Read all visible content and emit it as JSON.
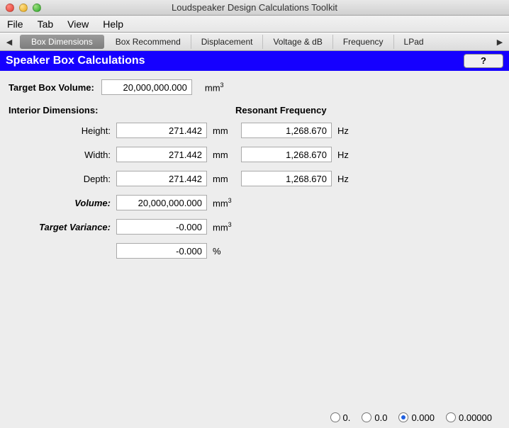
{
  "window": {
    "title": "Loudspeaker Design Calculations Toolkit"
  },
  "menubar": {
    "items": [
      "File",
      "Tab",
      "View",
      "Help"
    ]
  },
  "tabs": {
    "items": [
      "Box Dimensions",
      "Box Recommend",
      "Displacement",
      "Voltage & dB",
      "Frequency",
      "LPad"
    ],
    "active": "Box Dimensions",
    "scroll_left": "◀",
    "scroll_right": "▶"
  },
  "header": {
    "title": "Speaker Box Calculations",
    "help": "?"
  },
  "form": {
    "target_label": "Target Box Volume:",
    "target_value": "20,000,000.000",
    "target_unit": "mm",
    "interior_label": "Interior Dimensions:",
    "resonant_label": "Resonant Frequency",
    "rows": {
      "height": {
        "label": "Height:",
        "value": "271.442",
        "unit": "mm",
        "freq": "1,268.670",
        "freq_unit": "Hz"
      },
      "width": {
        "label": "Width:",
        "value": "271.442",
        "unit": "mm",
        "freq": "1,268.670",
        "freq_unit": "Hz"
      },
      "depth": {
        "label": "Depth:",
        "value": "271.442",
        "unit": "mm",
        "freq": "1,268.670",
        "freq_unit": "Hz"
      },
      "volume": {
        "label": "Volume:",
        "value": "20,000,000.000",
        "unit": "mm"
      },
      "variance": {
        "label": "Target Variance:",
        "value": "-0.000",
        "unit": "mm"
      },
      "variance_pct": {
        "value": "-0.000",
        "unit": "%"
      }
    }
  },
  "precision": {
    "options": [
      "0.",
      "0.0",
      "0.000",
      "0.00000"
    ],
    "selected": "0.000"
  }
}
